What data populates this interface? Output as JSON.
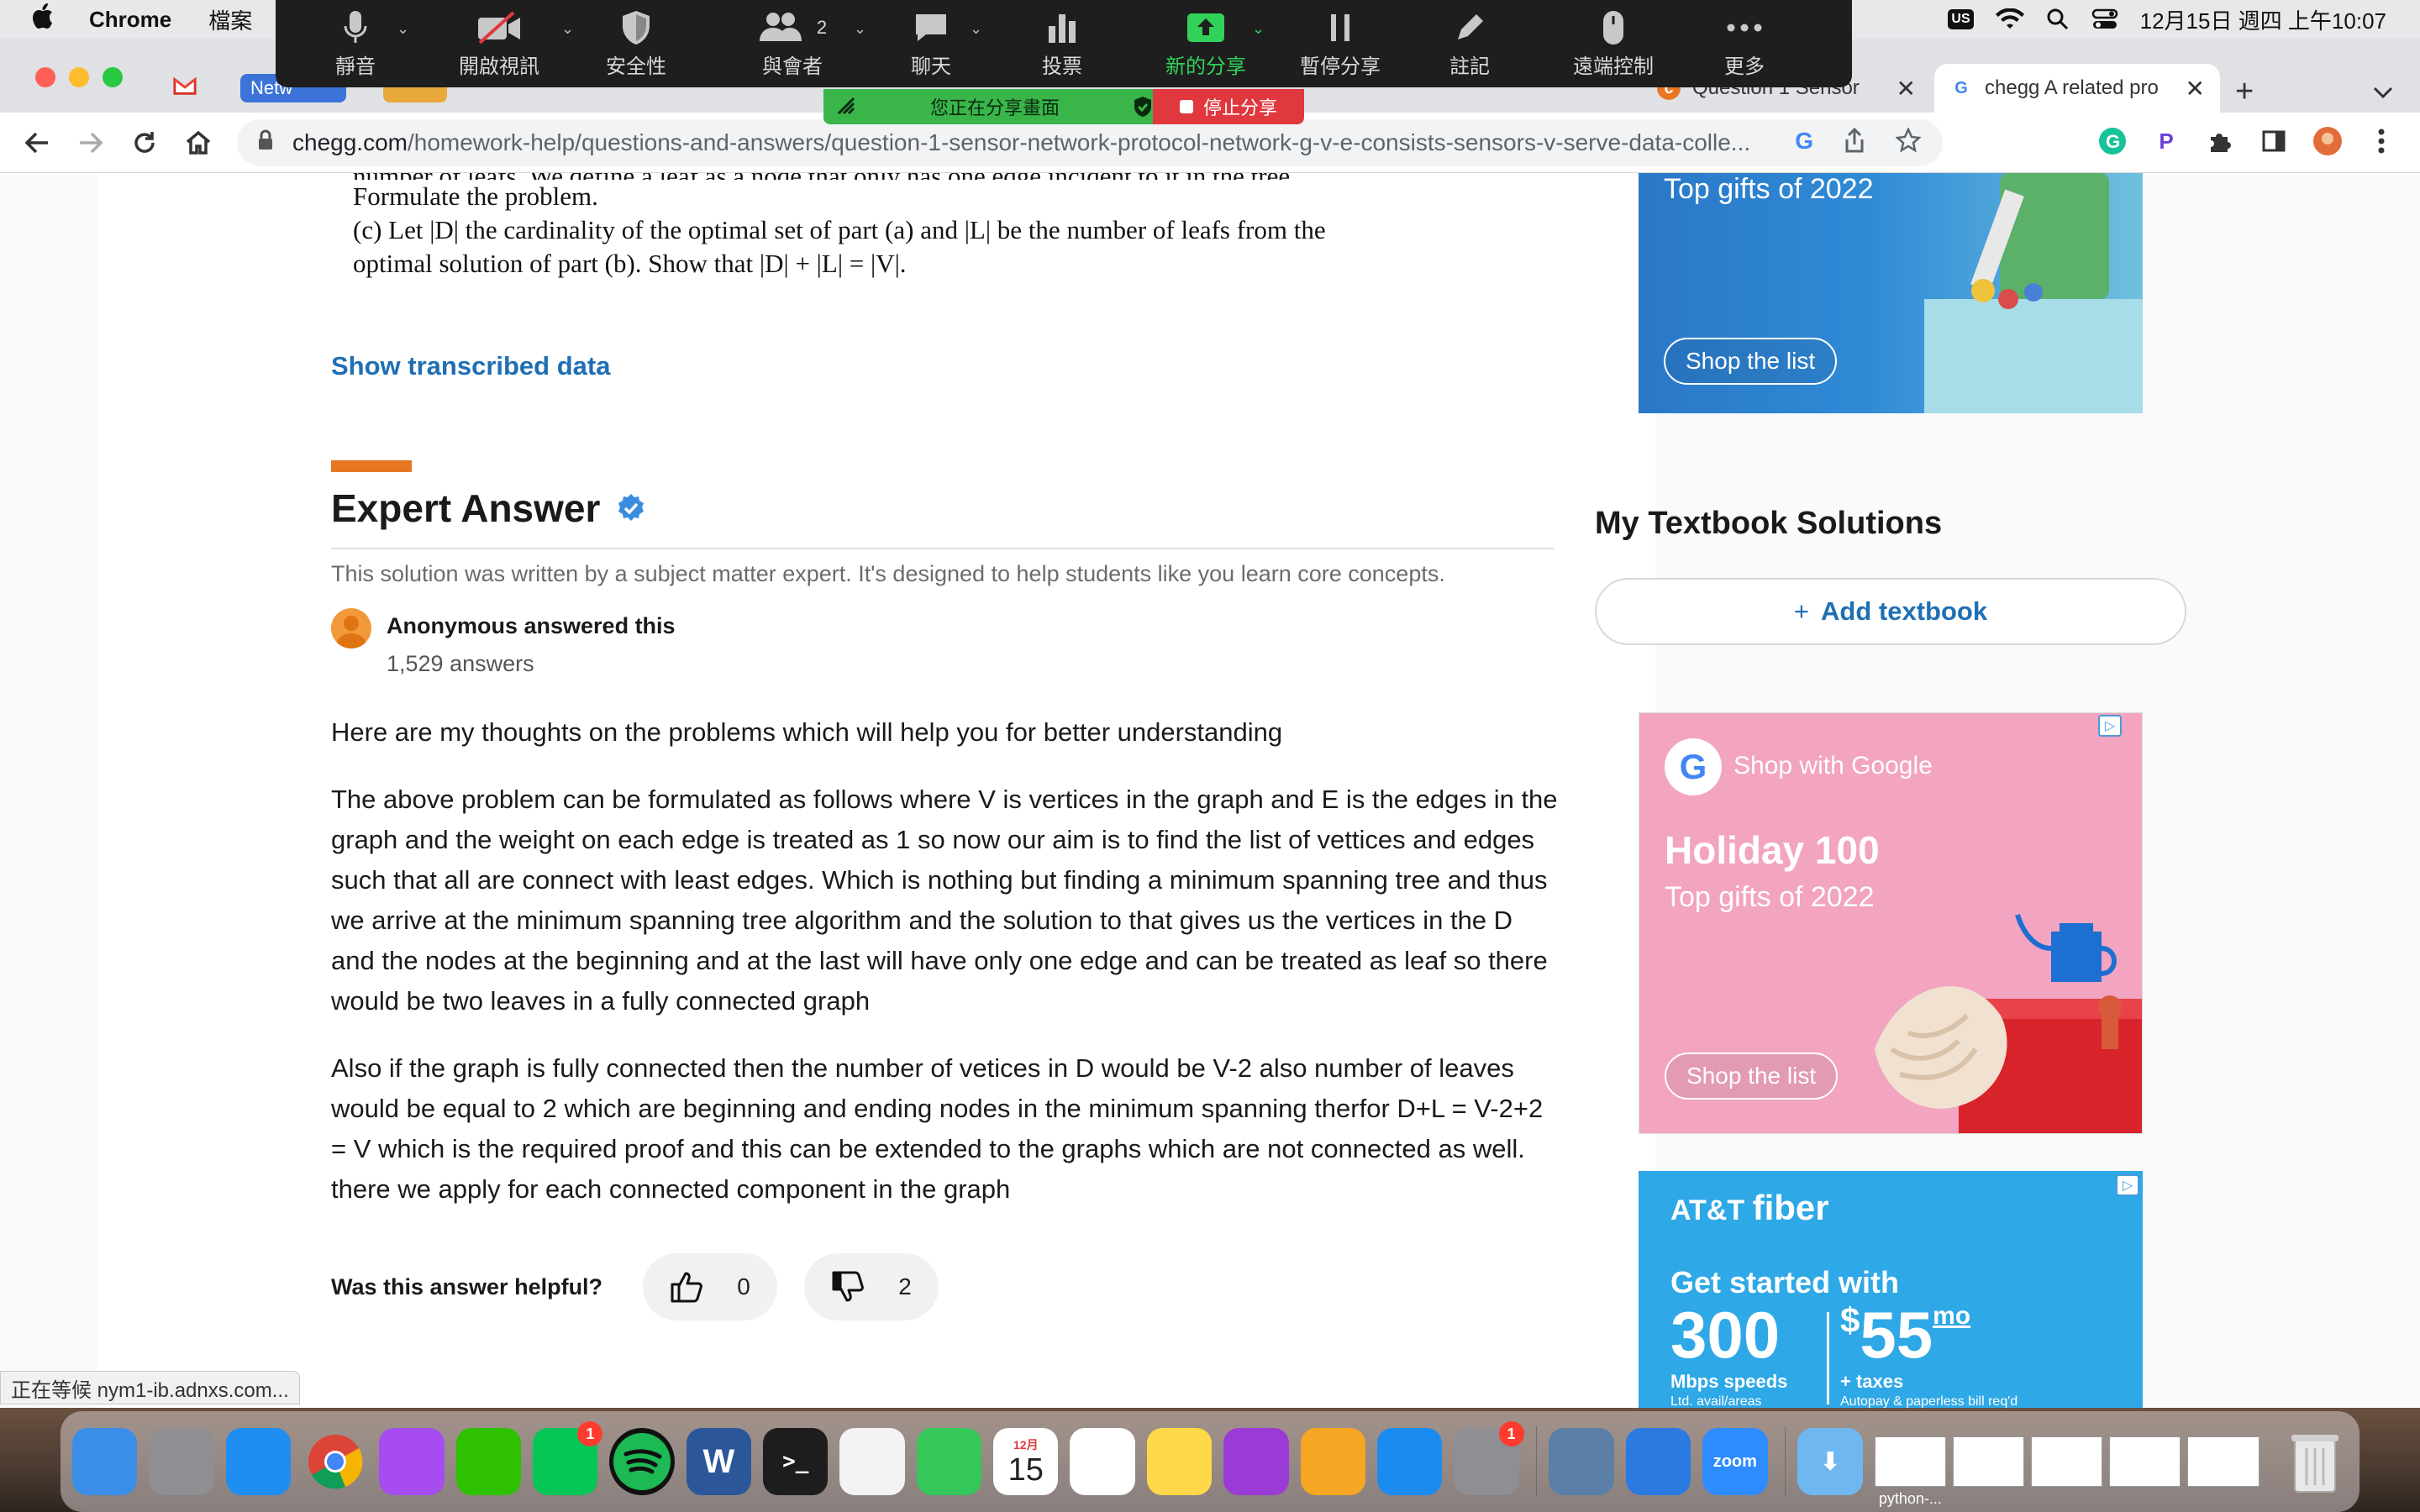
{
  "menubar": {
    "app_name": "Chrome",
    "menu_file": "檔案",
    "input_badge": "US",
    "datetime": "12月15日 週四 上午10:07"
  },
  "zoom": {
    "items": [
      {
        "label": "靜音",
        "icon": "microphone-icon",
        "caret": true
      },
      {
        "label": "開啟視訊",
        "icon": "video-off-icon",
        "caret": true
      },
      {
        "label": "安全性",
        "icon": "shield-icon",
        "caret": false
      },
      {
        "label": "與會者",
        "icon": "participants-icon",
        "count": "2",
        "caret": true
      },
      {
        "label": "聊天",
        "icon": "chat-icon",
        "caret": true
      },
      {
        "label": "投票",
        "icon": "poll-icon",
        "caret": false
      },
      {
        "label": "新的分享",
        "icon": "share-screen-icon",
        "caret": true,
        "active": true
      },
      {
        "label": "暫停分享",
        "icon": "pause-icon",
        "caret": false
      },
      {
        "label": "註記",
        "icon": "annotate-icon",
        "caret": false
      },
      {
        "label": "遠端控制",
        "icon": "remote-control-icon",
        "caret": false
      },
      {
        "label": "更多",
        "icon": "more-icon",
        "caret": false
      }
    ],
    "sharing_text": "您正在分享畫面",
    "stop_label": "停止分享"
  },
  "tabs": {
    "mini_tab_label": "Netw",
    "active_tab_label": "Question 1 Sensor",
    "last_tab_label": "chegg A related pro"
  },
  "address": {
    "domain": "chegg.com",
    "path": "/homework-help/questions-and-answers/question-1-sensor-network-protocol-network-g-v-e-consists-sensors-v-serve-data-colle..."
  },
  "question": {
    "line_cut": "number of leafs. We define a leaf as a node that only has one edge incident to it in the tree.",
    "line1": "Formulate the problem.",
    "line2": "(c) Let |D| the cardinality of the optimal set of part (a) and |L| be the number of leafs from the",
    "line3": "optimal solution of part (b). Show that |D| + |L| = |V|."
  },
  "show_transcribed": "Show transcribed data",
  "expert": {
    "title": "Expert Answer",
    "description": "This solution was written by a subject matter expert. It's designed to help students like you learn core concepts.",
    "author": "Anonymous answered this",
    "answer_count": "1,529 answers",
    "paragraphs": [
      "Here are my thoughts on the problems which will help you for better understanding",
      "The above problem can be formulated as follows where V is vertices in the graph and E is the edges in the graph and the weight on each edge is treated as 1 so now our aim is to find the list of vettices and edges such that all are connect with least edges. Which is nothing but finding a minimum spanning tree and thus we arrive at the minimum spanning tree algorithm and the solution to that gives us the vertices in the D and the nodes at the beginning and at the last will have only one edge and can be treated as leaf so there would be two leaves in a fully connected graph",
      "Also if the graph is fully connected then the number of vetices in D would be V-2 also number of leaves would be equal to 2 which are beginning and ending nodes in the minimum spanning therfor D+L = V-2+2 = V which is the required proof and this can be extended to the graphs which are not connected as well. there we apply for each connected component in the graph"
    ],
    "helpful_label": "Was this answer helpful?",
    "upvotes": "0",
    "downvotes": "2"
  },
  "sidebar": {
    "ad_top_sub": "Top gifts of 2022",
    "ad_top_cta": "Shop the list",
    "textbook_title": "My Textbook Solutions",
    "add_textbook": "Add textbook",
    "ad_mid": {
      "brand": "Shop with Google",
      "headline": "Holiday 100",
      "sub": "Top gifts of 2022",
      "cta": "Shop the list"
    },
    "ad_bottom": {
      "brand_prefix": "AT&T",
      "brand_suffix": "fiber",
      "tagline": "Get started with",
      "speed": "300",
      "speed_label": "Mbps speeds",
      "speed_fine": "Ltd. avail/areas",
      "price_currency": "$",
      "price": "55",
      "price_unit": "mo",
      "price_label": "+ taxes",
      "price_fine": "Autopay & paperless bill req'd"
    }
  },
  "status_tip": "正在等候 nym1-ib.adnxs.com...",
  "dock": {
    "apps": [
      {
        "name": "finder",
        "color": "#3b8ee8"
      },
      {
        "name": "launchpad",
        "color": "#8e8e93"
      },
      {
        "name": "safari",
        "color": "#1f8ef1"
      },
      {
        "name": "chrome",
        "color": "#e8e8e8"
      },
      {
        "name": "messenger",
        "color": "#a64cf0"
      },
      {
        "name": "wechat",
        "color": "#2dc100"
      },
      {
        "name": "line",
        "color": "#06c755",
        "badge": "1"
      },
      {
        "name": "spotify",
        "color": "#1db954"
      },
      {
        "name": "word",
        "color": "#2b579a"
      },
      {
        "name": "terminal",
        "color": "#1d1d1d"
      },
      {
        "name": "photos",
        "color": "#f3f3f3"
      },
      {
        "name": "facetime",
        "color": "#34c759"
      },
      {
        "name": "calendar",
        "color": "#ffffff",
        "month": "12月",
        "day": "15"
      },
      {
        "name": "reminders",
        "color": "#ffffff"
      },
      {
        "name": "notes",
        "color": "#ffd84a"
      },
      {
        "name": "podcasts",
        "color": "#9b3bd6"
      },
      {
        "name": "pages",
        "color": "#f5a623"
      },
      {
        "name": "app-store",
        "color": "#1a8cf0"
      },
      {
        "name": "system-preferences",
        "color": "#8e8e93",
        "badge": "1"
      },
      {
        "name": "preview",
        "color": "#5b7fa6"
      },
      {
        "name": "keynote",
        "color": "#2a7ae2"
      },
      {
        "name": "zoom",
        "color": "#2d8cff",
        "text": "zoom"
      }
    ],
    "window_label": "python-..."
  }
}
